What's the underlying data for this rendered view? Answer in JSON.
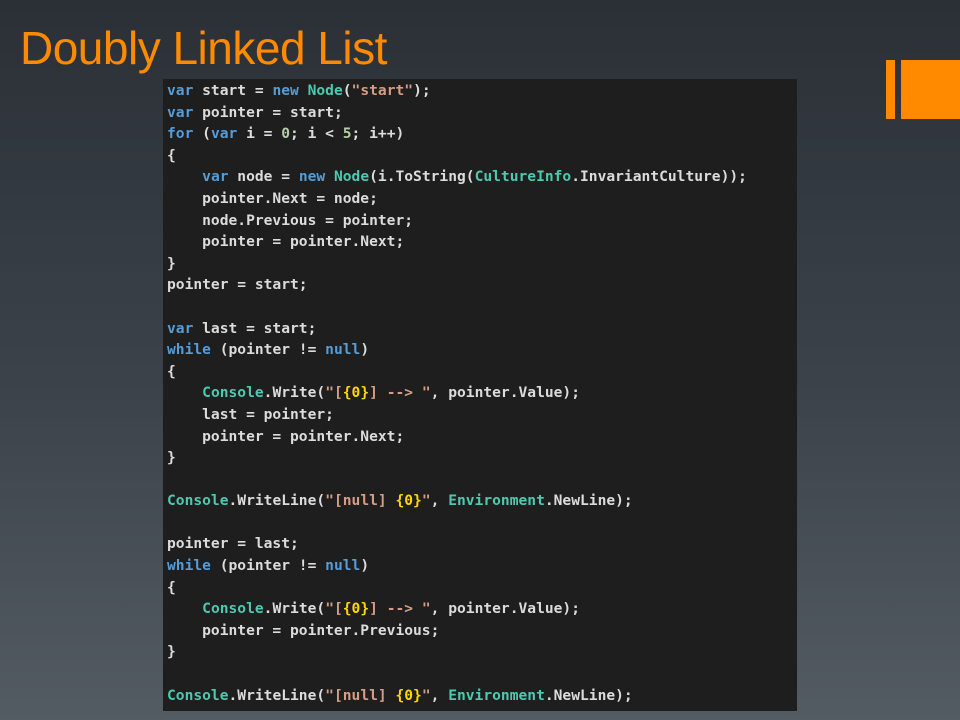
{
  "slide": {
    "title": "Doubly Linked List"
  },
  "code": {
    "lines": [
      [
        [
          "kw",
          "var"
        ],
        [
          "p",
          " start = "
        ],
        [
          "kw",
          "new"
        ],
        [
          "p",
          " "
        ],
        [
          "type",
          "Node"
        ],
        [
          "p",
          "("
        ],
        [
          "str",
          "\"start\""
        ],
        [
          "p",
          ");"
        ]
      ],
      [
        [
          "kw",
          "var"
        ],
        [
          "p",
          " pointer = start;"
        ]
      ],
      [
        [
          "kw",
          "for"
        ],
        [
          "p",
          " ("
        ],
        [
          "kw",
          "var"
        ],
        [
          "p",
          " i = "
        ],
        [
          "num",
          "0"
        ],
        [
          "p",
          "; i < "
        ],
        [
          "num",
          "5"
        ],
        [
          "p",
          "; i++)"
        ]
      ],
      [
        [
          "p",
          "{"
        ]
      ],
      [
        [
          "p",
          "    "
        ],
        [
          "kw",
          "var"
        ],
        [
          "p",
          " node = "
        ],
        [
          "kw",
          "new"
        ],
        [
          "p",
          " "
        ],
        [
          "type",
          "Node"
        ],
        [
          "p",
          "(i.ToString("
        ],
        [
          "type",
          "CultureInfo"
        ],
        [
          "p",
          ".InvariantCulture));"
        ]
      ],
      [
        [
          "p",
          "    pointer.Next = node;"
        ]
      ],
      [
        [
          "p",
          "    node.Previous = pointer;"
        ]
      ],
      [
        [
          "p",
          "    pointer = pointer.Next;"
        ]
      ],
      [
        [
          "p",
          "}"
        ]
      ],
      [
        [
          "p",
          "pointer = start;"
        ]
      ],
      [],
      [
        [
          "kw",
          "var"
        ],
        [
          "p",
          " last = start;"
        ]
      ],
      [
        [
          "kw",
          "while"
        ],
        [
          "p",
          " (pointer != "
        ],
        [
          "kw",
          "null"
        ],
        [
          "p",
          ")"
        ]
      ],
      [
        [
          "p",
          "{"
        ]
      ],
      [
        [
          "p",
          "    "
        ],
        [
          "type",
          "Console"
        ],
        [
          "p",
          ".Write("
        ],
        [
          "str",
          "\"["
        ],
        [
          "fmt",
          "{0}"
        ],
        [
          "str",
          "] --> \""
        ],
        [
          "p",
          ", pointer.Value);"
        ]
      ],
      [
        [
          "p",
          "    last = pointer;"
        ]
      ],
      [
        [
          "p",
          "    pointer = pointer.Next;"
        ]
      ],
      [
        [
          "p",
          "}"
        ]
      ],
      [],
      [
        [
          "type",
          "Console"
        ],
        [
          "p",
          ".WriteLine("
        ],
        [
          "str",
          "\"[null] "
        ],
        [
          "fmt",
          "{0}"
        ],
        [
          "str",
          "\""
        ],
        [
          "p",
          ", "
        ],
        [
          "type",
          "Environment"
        ],
        [
          "p",
          ".NewLine);"
        ]
      ],
      [],
      [
        [
          "p",
          "pointer = last;"
        ]
      ],
      [
        [
          "kw",
          "while"
        ],
        [
          "p",
          " (pointer != "
        ],
        [
          "kw",
          "null"
        ],
        [
          "p",
          ")"
        ]
      ],
      [
        [
          "p",
          "{"
        ]
      ],
      [
        [
          "p",
          "    "
        ],
        [
          "type",
          "Console"
        ],
        [
          "p",
          ".Write("
        ],
        [
          "str",
          "\"["
        ],
        [
          "fmt",
          "{0}"
        ],
        [
          "str",
          "] --> \""
        ],
        [
          "p",
          ", pointer.Value);"
        ]
      ],
      [
        [
          "p",
          "    pointer = pointer.Previous;"
        ]
      ],
      [
        [
          "p",
          "}"
        ]
      ],
      [],
      [
        [
          "type",
          "Console"
        ],
        [
          "p",
          ".WriteLine("
        ],
        [
          "str",
          "\"[null] "
        ],
        [
          "fmt",
          "{0}"
        ],
        [
          "str",
          "\""
        ],
        [
          "p",
          ", "
        ],
        [
          "type",
          "Environment"
        ],
        [
          "p",
          ".NewLine);"
        ]
      ]
    ]
  },
  "colors": {
    "title": "#ff8a00",
    "accent": "#ff8a00",
    "code_background": "#1e1e1e",
    "keyword": "#569cd6",
    "type": "#4ec9b0",
    "string": "#d69d85",
    "number": "#b5cea8",
    "format_placeholder": "#ffd700",
    "plain": "#dcdcdc"
  }
}
